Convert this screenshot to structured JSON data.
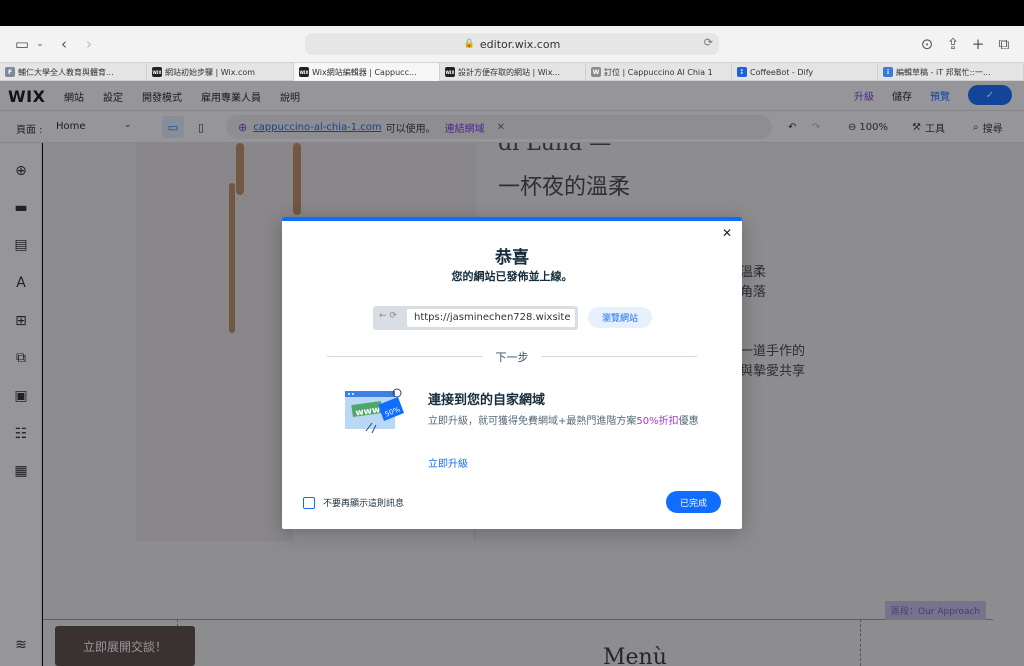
{
  "browser": {
    "url": "editor.wix.com",
    "tabs": [
      {
        "title": "輔仁大學全人教育與體育...",
        "fav": "F",
        "color": "#7d8a9a",
        "active": false
      },
      {
        "title": "網站初始步驟 | Wix.com",
        "fav": "WIX",
        "color": "#222222",
        "active": false
      },
      {
        "title": "Wix網站編輯器 | Cappucc...",
        "fav": "WIX",
        "color": "#222222",
        "active": true
      },
      {
        "title": "設計方便存取的網站 | Wix...",
        "fav": "WIX",
        "color": "#222222",
        "active": false
      },
      {
        "title": "訂位 | Cappuccino Al Chia 1",
        "fav": "W",
        "color": "#8a8a8a",
        "active": false
      },
      {
        "title": "CoffeeBot - Dify",
        "fav": "⁑",
        "color": "#1f5fe0",
        "active": false
      },
      {
        "title": "編輯草稿 - iT 邦幫忙::一...",
        "fav": "i",
        "color": "#3a7bd5",
        "active": false
      }
    ]
  },
  "wix_topbar": {
    "logo": "WIX",
    "menu": [
      "網站",
      "設定",
      "開發模式",
      "雇用專業人員",
      "說明"
    ],
    "upgrade": "升級",
    "save": "儲存",
    "preview": "預覽",
    "publish": "✓"
  },
  "toolbar": {
    "page_label": "頁面 :",
    "page_value": "Home",
    "domain": "cappuccino-al-chia-1.com",
    "available": "可以使用。",
    "connect": "連結網域",
    "zoom": "100%",
    "tools": "工具",
    "search": "搜尋"
  },
  "canvas": {
    "heading_line1": "di Luna —",
    "heading_line2": "一杯夜的溫柔",
    "side_lines_a": [
      "溫柔",
      "角落"
    ],
    "side_lines_b": [
      "一道手作的",
      "與摯愛共享"
    ],
    "section_label": "區段：Our Approach",
    "chat_button": "立即展開交談！",
    "menu_title": "Menù"
  },
  "modal": {
    "title": "恭喜",
    "subtitle": "您的網站已發佈並上線。",
    "site_url": "https://jasminechen728.wixsite",
    "view_site": "瀏覽網站",
    "next_step": "下一步",
    "art_text": "www",
    "art_badge": "50%",
    "promo_title": "連接到您的自家網域",
    "promo_desc_1": "立即升級，就可獲得免費網域+最熱門進階方案",
    "promo_highlight": "50%折扣",
    "promo_desc_2": "優惠",
    "promo_link": "立即升級",
    "dont_show": "不要再顯示這則訊息",
    "done": "已完成"
  },
  "colors": {
    "accent": "#116dff",
    "purple": "#7c3bdc",
    "highlight": "#a139d6"
  }
}
